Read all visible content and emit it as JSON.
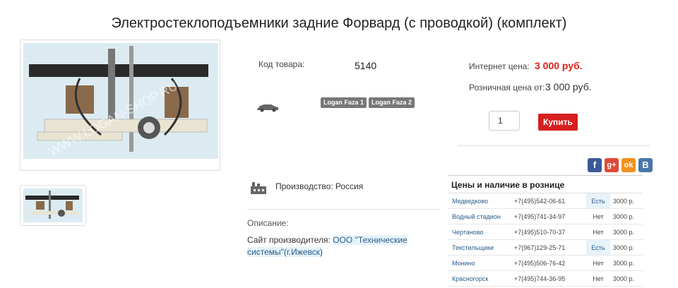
{
  "product": {
    "title": "Электростеклоподъемники задние Форвард (с проводкой) (комплект)",
    "watermark": "WWW.LOGAN-SHOP.RU",
    "code_label": "Код товара:",
    "code_value": "5140",
    "car_icon": "car-icon",
    "badges": [
      "Logan Faza 1",
      "Logan Faza 2"
    ]
  },
  "pricing": {
    "internet_label": "Интернет цена:",
    "internet_price": "3 000 руб.",
    "retail_label": "Розничная цена от:",
    "retail_price": "3 000 руб.",
    "quantity": "1",
    "buy_label": "Купить"
  },
  "social": [
    {
      "name": "facebook-icon",
      "glyph": "f",
      "color": "#3b5998"
    },
    {
      "name": "google-plus-icon",
      "glyph": "g+",
      "color": "#dd4b39"
    },
    {
      "name": "odnoklassniki-icon",
      "glyph": "ok",
      "color": "#f2901d"
    },
    {
      "name": "vkontakte-icon",
      "glyph": "B",
      "color": "#4a76a8"
    }
  ],
  "details": {
    "production_label": "Производство: Россия",
    "description_label": "Описание:",
    "site_label": "Сайт производителя: ",
    "site_link": "ООО \"Технические системы\"(г.Ижевск)"
  },
  "availability": {
    "title": "Цены и наличие в рознице",
    "rows": [
      {
        "city": "Медведково",
        "phone": "+7(495)542-06-61",
        "status": "Есть",
        "price": "3000 р."
      },
      {
        "city": "Водный стадион",
        "phone": "+7(495)741-34-97",
        "status": "Нет",
        "price": "3000 р."
      },
      {
        "city": "Чертаново",
        "phone": "+7(495)510-70-37",
        "status": "Нет",
        "price": "3000 р."
      },
      {
        "city": "Текстильщики",
        "phone": "+7(967)129-25-71",
        "status": "Есть",
        "price": "3000 р."
      },
      {
        "city": "Монино",
        "phone": "+7(495)506-76-42",
        "status": "Нет",
        "price": "3000 р."
      },
      {
        "city": "Красногорск",
        "phone": "+7(495)744-36-95",
        "status": "Нет",
        "price": "3000 р."
      }
    ]
  },
  "colors": {
    "accent_red": "#d61f1f",
    "link_blue": "#2b5b8a",
    "available_bg": "#e6f3fa"
  }
}
